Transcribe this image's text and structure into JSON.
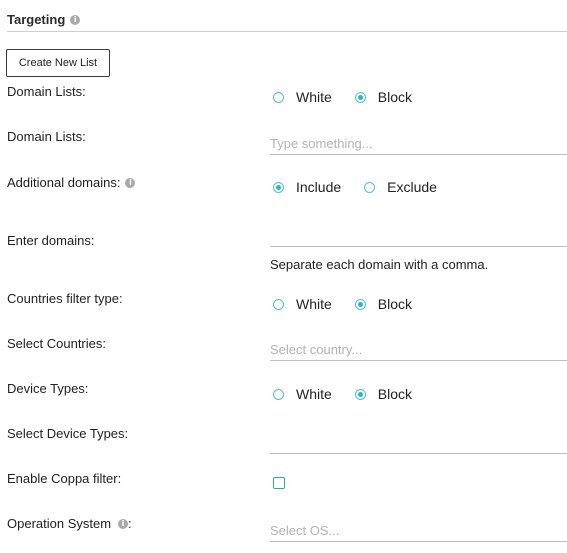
{
  "section": {
    "title": "Targeting",
    "info_icon": "i"
  },
  "create_button": "Create New List",
  "domain_lists_type": {
    "label": "Domain Lists:",
    "options": [
      "White",
      "Block"
    ],
    "selected": "Block"
  },
  "domain_lists": {
    "label": "Domain Lists:",
    "placeholder": "Type something..."
  },
  "additional_domains": {
    "label": "Additional domains:",
    "options": [
      "Include",
      "Exclude"
    ],
    "selected": "Include"
  },
  "enter_domains": {
    "label": "Enter domains:",
    "value": "",
    "hint": "Separate each domain with a comma."
  },
  "countries_filter": {
    "label": "Countries filter type:",
    "options": [
      "White",
      "Block"
    ],
    "selected": "Block"
  },
  "select_countries": {
    "label": "Select Countries:",
    "placeholder": "Select country..."
  },
  "device_types": {
    "label": "Device Types:",
    "options": [
      "White",
      "Block"
    ],
    "selected": "Block"
  },
  "select_device_types": {
    "label": "Select Device Types:",
    "value": ""
  },
  "coppa": {
    "label": "Enable Coppa filter:",
    "checked": false
  },
  "operation_system": {
    "label": "Operation System",
    "label_suffix": ":",
    "placeholder": "Select OS..."
  },
  "colors": {
    "accent": "#2ab7b7",
    "radio_border": "#4fc3c6",
    "line": "#bdbdbd"
  },
  "icons": [
    "info-icon",
    "radio-icon",
    "checkbox-icon"
  ]
}
